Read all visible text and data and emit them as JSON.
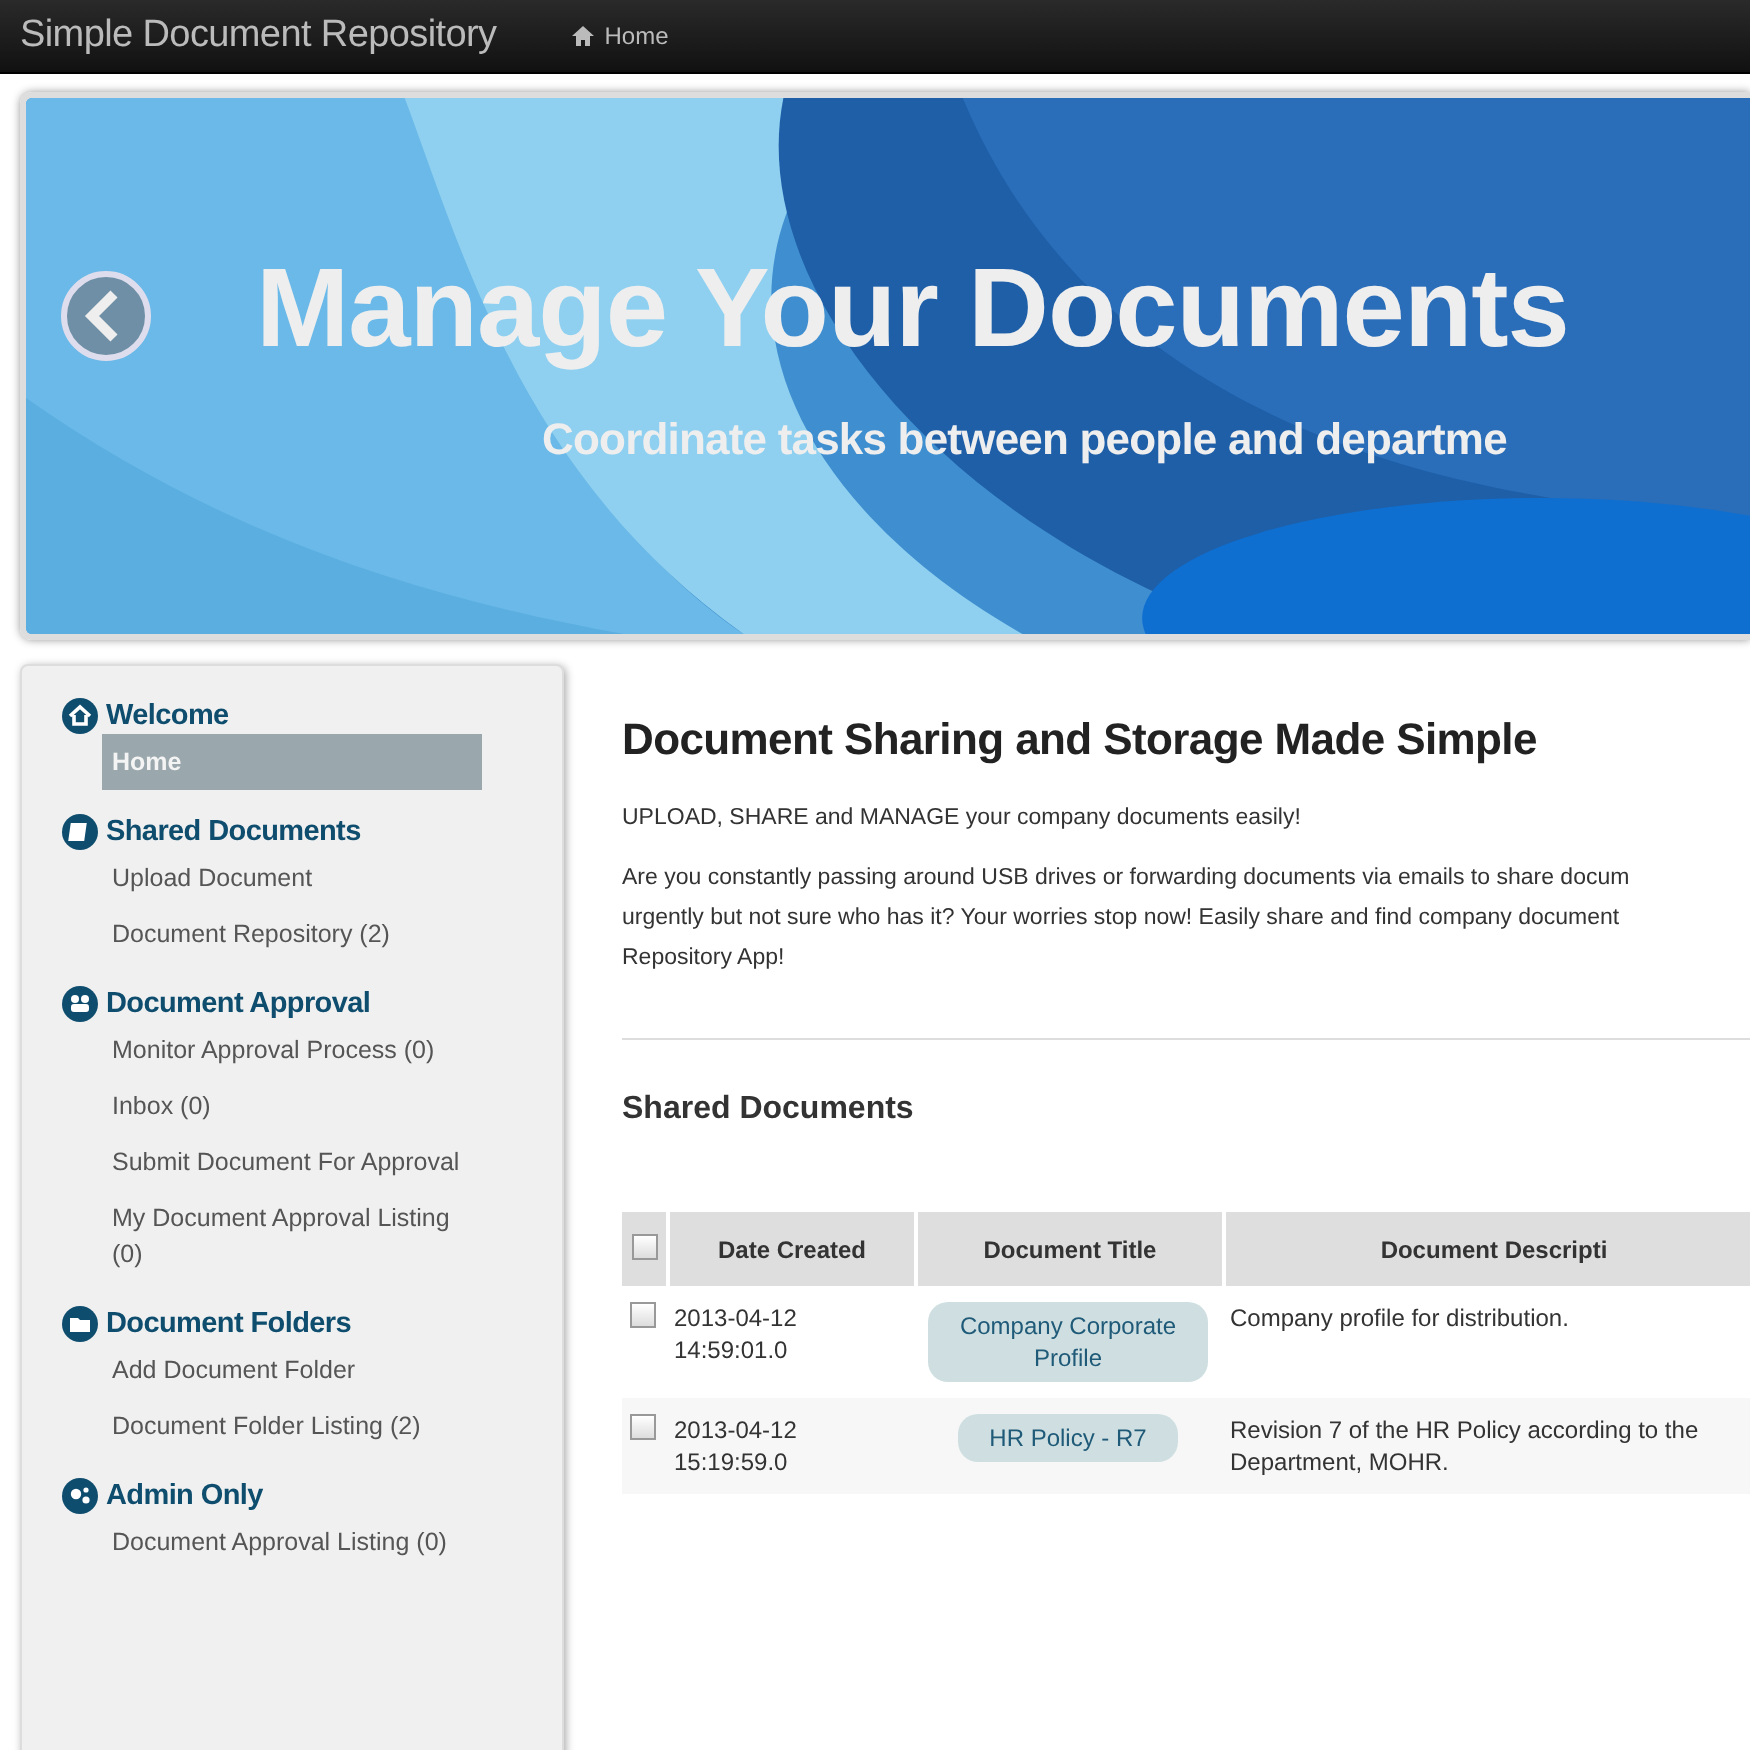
{
  "navbar": {
    "brand": "Simple Document Repository",
    "links": [
      {
        "label": "Home"
      }
    ]
  },
  "banner": {
    "title": "Manage Your Documents",
    "subtitle": "Coordinate tasks between people and departme"
  },
  "sidebar": {
    "sections": [
      {
        "title": "Welcome",
        "items": [
          {
            "label": "Home",
            "selected": true
          }
        ]
      },
      {
        "title": "Shared Documents",
        "items": [
          {
            "label": "Upload Document",
            "selected": false
          },
          {
            "label": "Document Repository (2)",
            "selected": false
          }
        ]
      },
      {
        "title": "Document Approval",
        "items": [
          {
            "label": "Monitor Approval Process (0)",
            "selected": false
          },
          {
            "label": "Inbox (0)",
            "selected": false
          },
          {
            "label": "Submit Document For Approval",
            "selected": false
          },
          {
            "label": "My Document Approval Listing (0)",
            "selected": false
          }
        ]
      },
      {
        "title": "Document Folders",
        "items": [
          {
            "label": "Add Document Folder",
            "selected": false
          },
          {
            "label": "Document Folder Listing (2)",
            "selected": false
          }
        ]
      },
      {
        "title": "Admin Only",
        "items": [
          {
            "label": "Document Approval Listing (0)",
            "selected": false
          }
        ]
      }
    ]
  },
  "main": {
    "heading": "Document Sharing and Storage Made Simple",
    "intro": "UPLOAD, SHARE and MANAGE your company documents easily!",
    "paragraph": "Are you constantly passing around USB drives or forwarding documents via emails to share docum\nurgently but not sure who has it? Your worries stop now! Easily share and find company document\nRepository App!",
    "section_title": "Shared Documents",
    "table": {
      "select_all": {
        "checked": false
      },
      "columns": [
        "Date Created",
        "Document Title",
        "Document Descripti"
      ],
      "rows": [
        {
          "checked": false,
          "date": "2013-04-12\n14:59:01.0",
          "title": "Company Corporate\nProfile",
          "description": "Company profile for distribution."
        },
        {
          "checked": false,
          "date": "2013-04-12\n15:19:59.0",
          "title": "HR Policy - R7",
          "description": "Revision 7 of the HR Policy according to the\nDepartment, MOHR."
        }
      ]
    }
  }
}
